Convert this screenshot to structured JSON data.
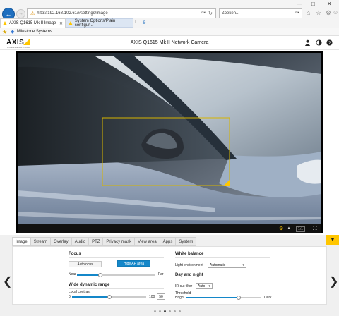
{
  "browser": {
    "url": "http://192.168.102.61/#settings/image",
    "search_placeholder": "Zoeken...",
    "tabs": [
      {
        "label": "AXIS Q1615 Mk II Image",
        "active": true
      },
      {
        "label": "System Options/Plain configur...",
        "active": false
      }
    ],
    "favorites": [
      {
        "label": "Milestone Systems"
      }
    ],
    "window_controls": {
      "minimize": "—",
      "maximize": "□",
      "close": "✕"
    }
  },
  "header": {
    "logo": "AXIS",
    "logo_sub": "COMMUNICATIONS",
    "title": "AXIS Q1615 Mk II Network Camera"
  },
  "view": {
    "zoom_label": "1:1"
  },
  "settings": {
    "tabs": [
      "Image",
      "Stream",
      "Overlay",
      "Audio",
      "PTZ",
      "Privacy mask",
      "View area",
      "Apps",
      "System"
    ],
    "focus": {
      "heading": "Focus",
      "autofocus_label": "Autofocus",
      "hide_af_label": "Hide AF area",
      "near_label": "Near",
      "far_label": "Far",
      "focus_position": 0.3
    },
    "wdr": {
      "heading": "Wide dynamic range",
      "local_contrast_label": "Local contrast",
      "min": "0",
      "max": "100",
      "value": "50",
      "value_fraction": 0.5
    },
    "white_balance": {
      "heading": "White balance",
      "light_env_label": "Light environment",
      "light_env_value": "Automatic"
    },
    "day_night": {
      "heading": "Day and night",
      "ir_cut_label": "IR-cut filter",
      "ir_cut_value": "Auto",
      "threshold_label": "Threshold",
      "bright_label": "Bright",
      "dark_label": "Dark",
      "threshold_position": 0.7
    }
  },
  "pager": {
    "count": 6,
    "active": 2
  }
}
